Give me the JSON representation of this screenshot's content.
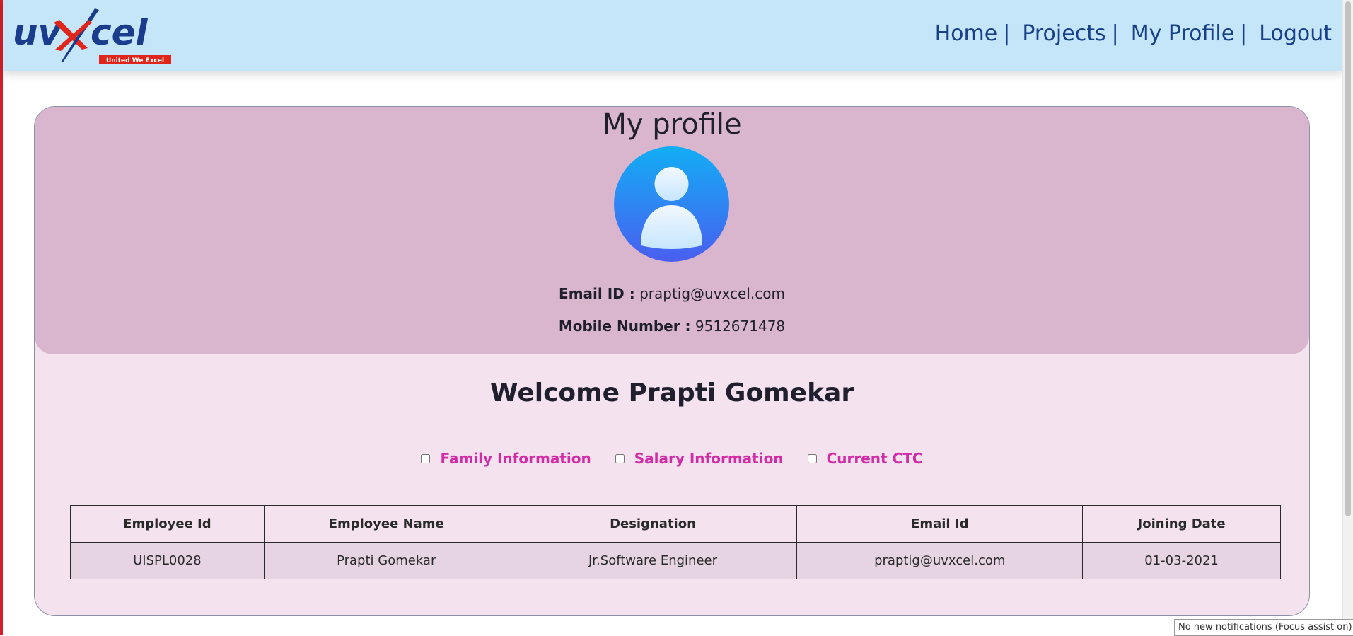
{
  "logo": {
    "text_left": "uv",
    "text_right": "cel",
    "tagline": "United We Excel"
  },
  "nav": {
    "items": [
      {
        "label": "Home",
        "sep": "|"
      },
      {
        "label": "Projects",
        "sep": "|"
      },
      {
        "label": "My Profile",
        "sep": "|"
      },
      {
        "label": "Logout",
        "sep": ""
      }
    ]
  },
  "profile": {
    "title": "My profile",
    "email_label": "Email ID :",
    "email_value": "praptig@uvxcel.com",
    "mobile_label": "Mobile Number :",
    "mobile_value": "9512671478"
  },
  "welcome": "Welcome Prapti Gomekar",
  "checkboxes": [
    {
      "label": "Family Information",
      "checked": false
    },
    {
      "label": "Salary Information",
      "checked": false
    },
    {
      "label": "Current CTC",
      "checked": false
    }
  ],
  "table": {
    "headers": [
      "Employee Id",
      "Employee Name",
      "Designation",
      "Email Id",
      "Joining Date"
    ],
    "rows": [
      [
        "UISPL0028",
        "Prapti Gomekar",
        "Jr.Software Engineer",
        "praptig@uvxcel.com",
        "01-03-2021"
      ]
    ]
  },
  "notification": "No new notifications (Focus assist on)",
  "colors": {
    "header_bg": "#c5e5f8",
    "nav_text": "#173f8a",
    "card_bg": "#f4e2ef",
    "card_top_bg": "#d9b6ce",
    "checkbox_label": "#d12ca6",
    "logo_blue": "#1a3c8c",
    "logo_red": "#e0251b"
  },
  "icons": {
    "avatar": "user-avatar-icon",
    "logo_mark": "x-swoosh-icon"
  }
}
